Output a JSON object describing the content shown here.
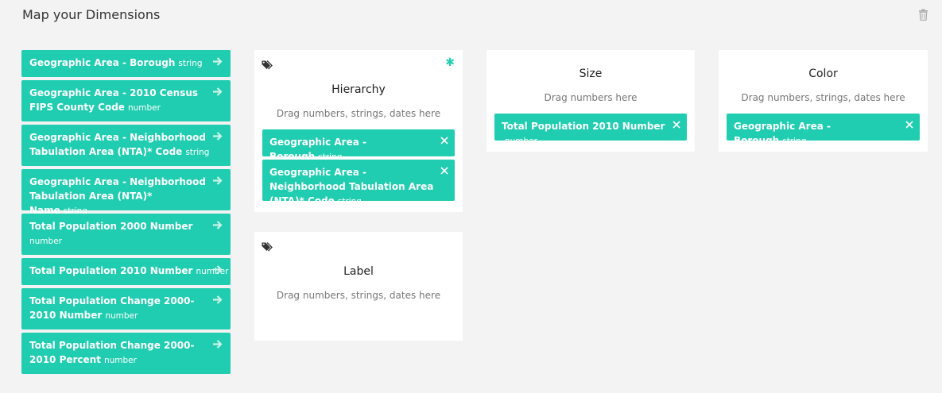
{
  "page": {
    "title": "Map your Dimensions"
  },
  "dimensions": [
    {
      "label": "Geographic Area - Borough",
      "type": "string"
    },
    {
      "label": "Geographic Area - 2010 Census FIPS County Code",
      "type": "number"
    },
    {
      "label": "Geographic Area - Neighborhood Tabulation Area (NTA)* Code",
      "type": "string"
    },
    {
      "label": "Geographic Area - Neighborhood Tabulation Area (NTA)* Name",
      "type": "string"
    },
    {
      "label": "Total Population 2000 Number",
      "type": "number"
    },
    {
      "label": "Total Population 2010 Number",
      "type": "number"
    },
    {
      "label": "Total Population Change 2000-2010 Number",
      "type": "number"
    },
    {
      "label": "Total Population Change 2000-2010 Percent",
      "type": "number"
    }
  ],
  "cards": {
    "hierarchy": {
      "title": "Hierarchy",
      "required_mark": "✱",
      "hint": "Drag numbers, strings, dates here",
      "items": [
        {
          "label": "Geographic Area - Borough",
          "type": "string"
        },
        {
          "label": "Geographic Area - Neighborhood Tabulation Area (NTA)* Code",
          "type": "string"
        }
      ]
    },
    "size": {
      "title": "Size",
      "hint": "Drag numbers here",
      "items": [
        {
          "label": "Total Population 2010 Number",
          "type": "number"
        }
      ]
    },
    "color": {
      "title": "Color",
      "hint": "Drag numbers, strings, dates here",
      "items": [
        {
          "label": "Geographic Area - Borough",
          "type": "string"
        }
      ]
    },
    "label": {
      "title": "Label",
      "hint": "Drag numbers, strings, dates here",
      "items": []
    }
  },
  "colors": {
    "accent": "#21cdb0",
    "background": "#f3f3f3",
    "card": "#ffffff"
  },
  "icons": {
    "trash": "trash-icon",
    "arrow": "arrow-right-icon",
    "tag": "tags-icon",
    "remove": "close-icon"
  }
}
